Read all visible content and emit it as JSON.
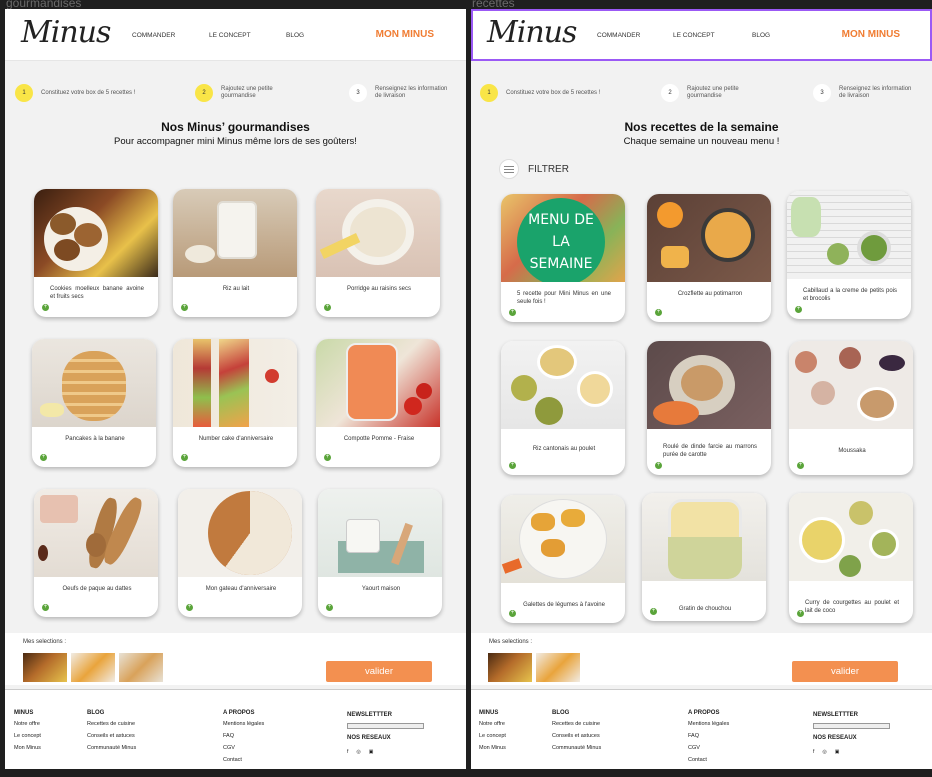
{
  "frames": [
    {
      "label": "gourmandises",
      "logo": "Minus",
      "nav": [
        "COMMANDER",
        "LE CONCEPT",
        "BLOG"
      ],
      "account": "MON MINUS",
      "steps": [
        {
          "n": "1",
          "text": "Constituez votre box de 5 recettes !",
          "active": true
        },
        {
          "n": "2",
          "text": "Rajoutez une petite gourmandise",
          "active": true
        },
        {
          "n": "3",
          "text": "Renseignez les information de livraison",
          "active": false
        }
      ],
      "title": "Nos Minus’ gourmandises",
      "subtitle": "Pour accompagner mini Minus même lors de ses goûters!",
      "cards": [
        {
          "caption": "Cookies moelleux banane avoine et fruits secs"
        },
        {
          "caption": "Riz au lait"
        },
        {
          "caption": "Porridge au raisins secs"
        },
        {
          "caption": "Pancakes à la banane"
        },
        {
          "caption": "Number cake d'anniversaire"
        },
        {
          "caption": "Compotte Pomme - Fraise"
        },
        {
          "caption": "Oeufs de paque au dattes"
        },
        {
          "caption": "Mon gateau d'anniversaire"
        },
        {
          "caption": "Yaourt maison"
        }
      ],
      "selections_label": "Mes selections :",
      "validate": "valider",
      "footer": {
        "col1": {
          "title": "MINUS",
          "items": [
            "Notre offre",
            "Le concept",
            "Mon Minus"
          ]
        },
        "col2": {
          "title": "BLOG",
          "items": [
            "Recettes de cuisine",
            "Conseils et astuces",
            "Communauté Minus"
          ]
        },
        "col3": {
          "title": "A PROPOS",
          "items": [
            "Mentions légales",
            "FAQ",
            "CGV",
            "Contact"
          ]
        },
        "newsletter": "NEWSLETTTER",
        "social": "NOS RESEAUX",
        "social_icons": [
          "f",
          "◎",
          "▣"
        ]
      }
    },
    {
      "label": "recettes",
      "logo": "Minus",
      "nav": [
        "COMMANDER",
        "LE CONCEPT",
        "BLOG"
      ],
      "account": "MON MINUS",
      "steps": [
        {
          "n": "1",
          "text": "Constituez votre box de 5 recettes !",
          "active": true
        },
        {
          "n": "2",
          "text": "Rajoutez une petite gourmandise",
          "active": false
        },
        {
          "n": "3",
          "text": "Renseignez les information de livraison",
          "active": false
        }
      ],
      "title": "Nos recettes de la semaine",
      "subtitle": "Chaque semaine un nouveau menu !",
      "filter": "FILTRER",
      "menu_badge": "MENU DE LA SEMAINE",
      "cards": [
        {
          "caption": "5 recette pour Mini Minus en une seule fois !"
        },
        {
          "caption": "Crozflette au potimarron"
        },
        {
          "caption": "Cabillaud a la creme de petits pois et brocolis"
        },
        {
          "caption": "Riz cantonais au poulet"
        },
        {
          "caption": "Roulé de dinde farcie au marrons purée de carotte"
        },
        {
          "caption": "Moussaka"
        },
        {
          "caption": "Galettes de légumes à l'avoine"
        },
        {
          "caption": "Gratin de chouchou"
        },
        {
          "caption": "Curry de courgettes au poulet et lait de coco"
        }
      ],
      "selections_label": "Mes selections :",
      "validate": "valider",
      "footer": {
        "col1": {
          "title": "MINUS",
          "items": [
            "Notre offre",
            "Le concept",
            "Mon Minus"
          ]
        },
        "col2": {
          "title": "BLOG",
          "items": [
            "Recettes de cuisine",
            "Conseils et astuces",
            "Communauté Minus"
          ]
        },
        "col3": {
          "title": "A PROPOS",
          "items": [
            "Mentions légales",
            "FAQ",
            "CGV",
            "Contact"
          ]
        },
        "newsletter": "NEWSLETTTER",
        "social": "NOS RESEAUX",
        "social_icons": [
          "f",
          "◎",
          "▣"
        ]
      }
    }
  ]
}
